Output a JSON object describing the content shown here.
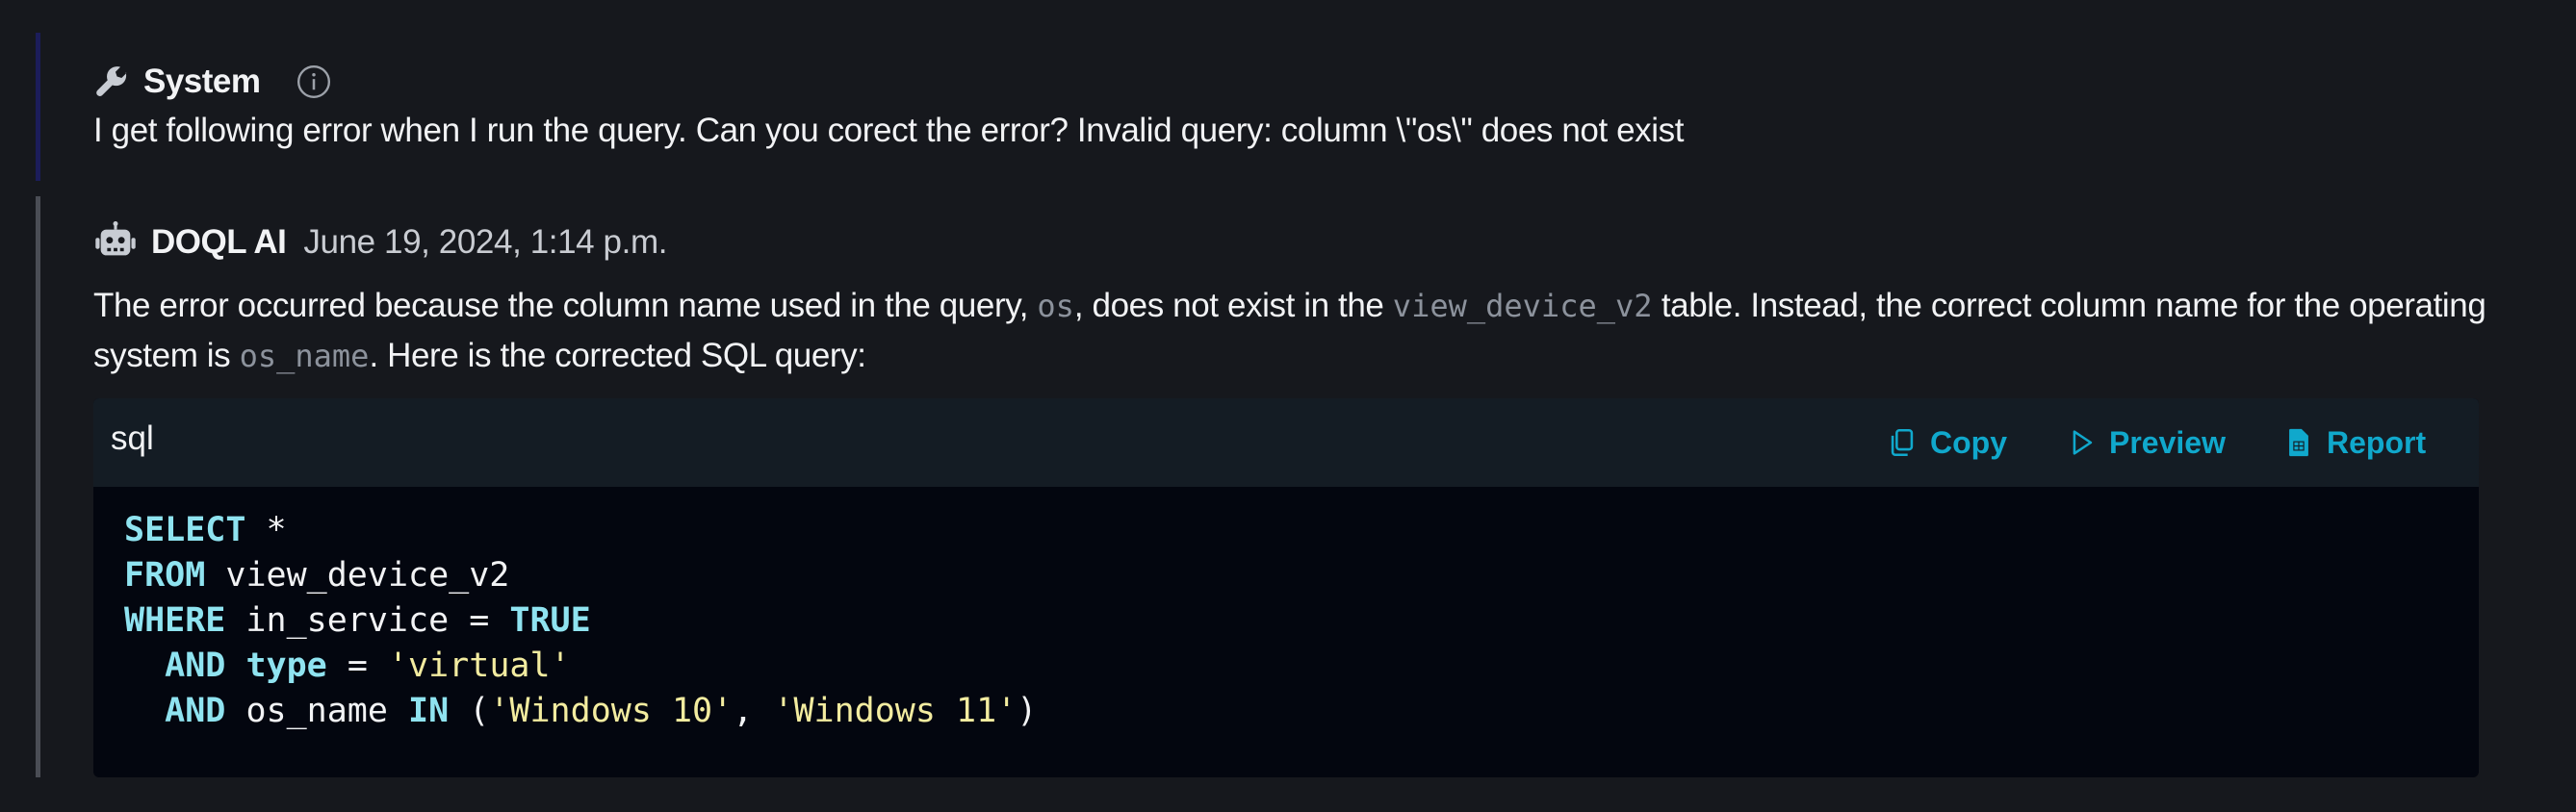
{
  "system_message": {
    "sender": "System",
    "text": "I get following error when I run the query. Can you corect the error? Invalid query: column \\\"os\\\" does not exist",
    "icon": "wrench-icon",
    "info_icon": "info-icon"
  },
  "ai_message": {
    "sender": "DOQL AI",
    "timestamp": "June 19, 2024, 1:14 p.m.",
    "icon": "robot-icon",
    "paragraph": {
      "t1": "The error occurred because the column name used in the query, ",
      "code1": "os",
      "t2": ", does not exist in the ",
      "code2": "view_device_v2",
      "t3": " table. Instead, the correct column name for the operating system is ",
      "code3": "os_name",
      "t4": ". Here is the corrected SQL query:"
    },
    "code_block": {
      "language": "sql",
      "buttons": {
        "copy": "Copy",
        "preview": "Preview",
        "report": "Report"
      },
      "lines": {
        "l1_kw": "SELECT",
        "l1_rest": " *",
        "l2_kw": "FROM",
        "l2_rest": " view_device_v2",
        "l3_kw": "WHERE",
        "l3_mid": " in_service = ",
        "l3_kw2": "TRUE",
        "l4_indent": "  ",
        "l4_kw": "AND",
        "l4_sp": " ",
        "l4_kw2": "type",
        "l4_mid": " = ",
        "l4_str": "'virtual'",
        "l5_indent": "  ",
        "l5_kw": "AND",
        "l5_mid": " os_name ",
        "l5_kw2": "IN",
        "l5_open": " (",
        "l5_str1": "'Windows 10'",
        "l5_comma": ", ",
        "l5_str2": "'Windows 11'",
        "l5_close": ")"
      }
    }
  },
  "colors": {
    "background": "#16181d",
    "accent": "#10a8cc",
    "system_bar": "#1c1d5a",
    "ai_bar": "#4a4d55",
    "code_keyword": "#8fe3f0",
    "code_string": "#f3eca0"
  }
}
